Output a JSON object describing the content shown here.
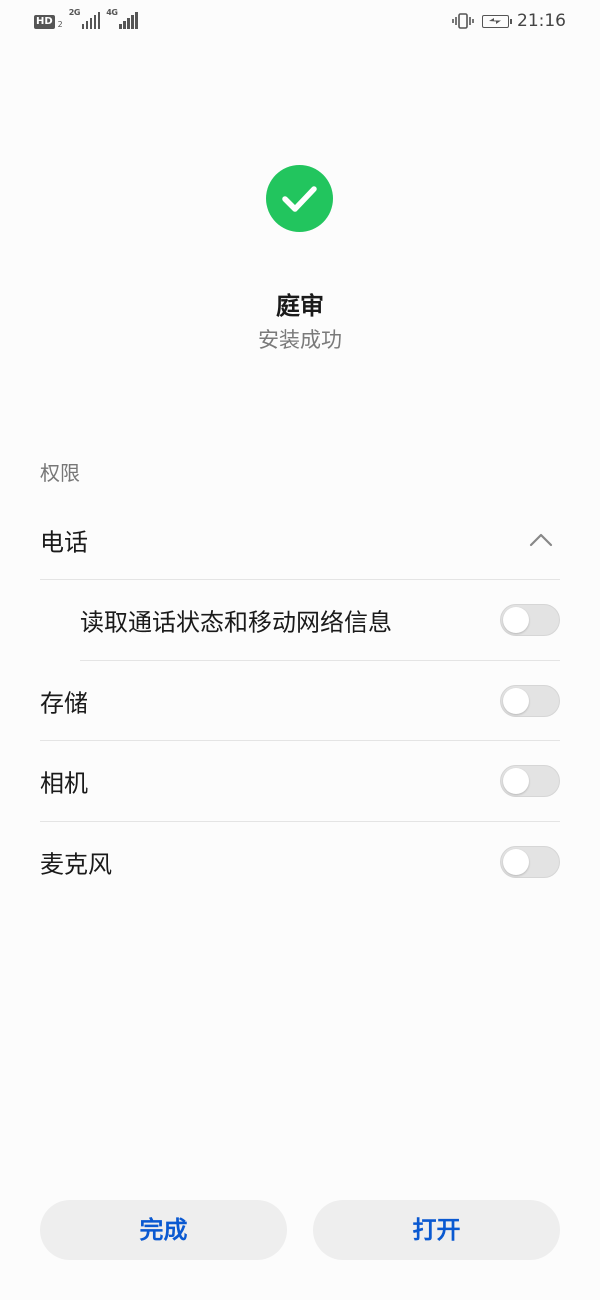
{
  "status_bar": {
    "hd_label": "HD",
    "sim_number": "2",
    "network_1": "2G",
    "network_2": "4G",
    "time": "21:16",
    "icons": [
      "hd-icon",
      "signal-icon",
      "vibrate-icon",
      "battery-charging-icon"
    ]
  },
  "header": {
    "icon": "check-circle-icon",
    "icon_color": "#22c55e",
    "app_name": "庭审",
    "status": "安装成功"
  },
  "permissions": {
    "section_label": "权限",
    "items": [
      {
        "label": "电话",
        "control": "chevron-up-icon",
        "expanded": true
      },
      {
        "label": "读取通话状态和移动网络信息",
        "enabled": false
      },
      {
        "label": "存储",
        "enabled": false
      },
      {
        "label": "相机",
        "enabled": false
      },
      {
        "label": "麦克风",
        "enabled": false
      }
    ]
  },
  "buttons": {
    "done": "完成",
    "open": "打开"
  },
  "colors": {
    "accent": "#0a59d1",
    "success": "#22c55e",
    "button_bg": "#eeeeee"
  }
}
